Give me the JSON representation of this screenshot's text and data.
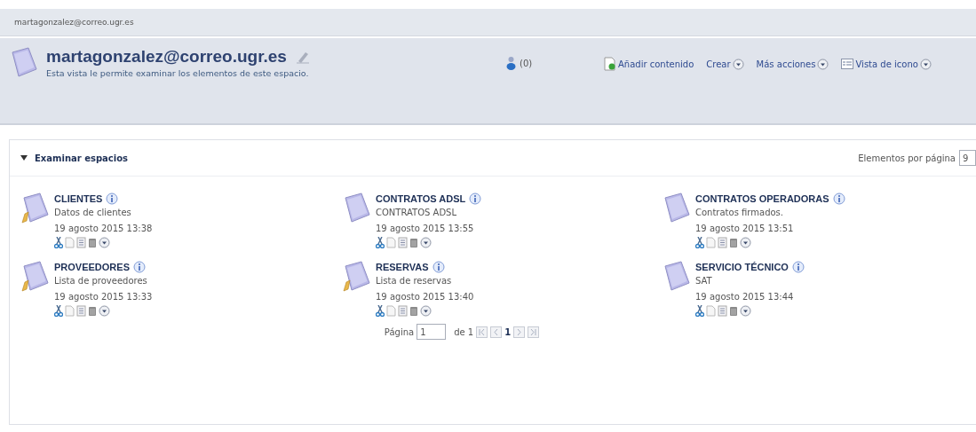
{
  "breadcrumb": "martagonzalez@correo.ugr.es",
  "header": {
    "title": "martagonzalez@correo.ugr.es",
    "description": "Esta vista le permite examinar los elementos de este espacio.",
    "count": "(0)",
    "actions": [
      {
        "label": "Añadir contenido",
        "kind": "add"
      },
      {
        "label": "Crear",
        "kind": "menu"
      },
      {
        "label": "Más acciones",
        "kind": "menu"
      },
      {
        "label": "Vista de icono",
        "kind": "view"
      }
    ]
  },
  "panel": {
    "title": "Examinar espacios",
    "expanded": true,
    "per_page_label": "Elementos por página",
    "per_page": "9",
    "spaces": [
      {
        "name": "CLIENTES",
        "description": "Datos de clientes",
        "date": "19 agosto 2015 13:38",
        "editable": true
      },
      {
        "name": "CONTRATOS ADSL",
        "description": "CONTRATOS ADSL",
        "date": "19 agosto 2015 13:55",
        "editable": false
      },
      {
        "name": "CONTRATOS OPERADORAS",
        "description": "Contratos firmados.",
        "date": "19 agosto 2015 13:51",
        "editable": false
      },
      {
        "name": "PROVEEDORES",
        "description": "Lista de proveedores",
        "date": "19 agosto 2015 13:33",
        "editable": true
      },
      {
        "name": "RESERVAS",
        "description": "Lista de reservas",
        "date": "19 agosto 2015 13:40",
        "editable": true
      },
      {
        "name": "SERVICIO TÉCNICO",
        "description": "SAT",
        "date": "19 agosto 2015 13:44",
        "editable": false
      }
    ],
    "pagination": {
      "label": "Página",
      "page": "1",
      "of": "de 1",
      "current": "1"
    }
  }
}
